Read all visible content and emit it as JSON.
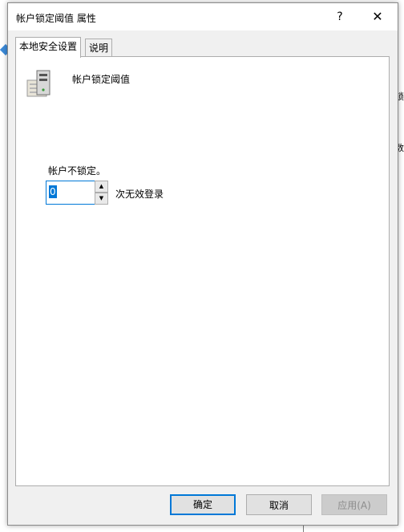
{
  "dialog": {
    "title": "帐户锁定阈值 属性",
    "help_glyph": "?",
    "close_glyph": "✕"
  },
  "tabs": [
    {
      "label": "本地安全设置",
      "active": true
    },
    {
      "label": "说明",
      "active": false
    }
  ],
  "panel": {
    "policy_name": "帐户锁定阈值",
    "lockout_status": "帐户不锁定。",
    "threshold_value": "0",
    "attempts_label": "次无效登录",
    "spin_up_glyph": "▲",
    "spin_down_glyph": "▼"
  },
  "buttons": {
    "ok": "确定",
    "cancel": "取消",
    "apply": "应用(A)"
  },
  "background": {
    "frag_right_1": "锁",
    "frag_right_2": "数"
  },
  "colors": {
    "accent": "#0078d7",
    "dialog_bg": "#f0f0f0",
    "panel_bg": "#ffffff"
  }
}
